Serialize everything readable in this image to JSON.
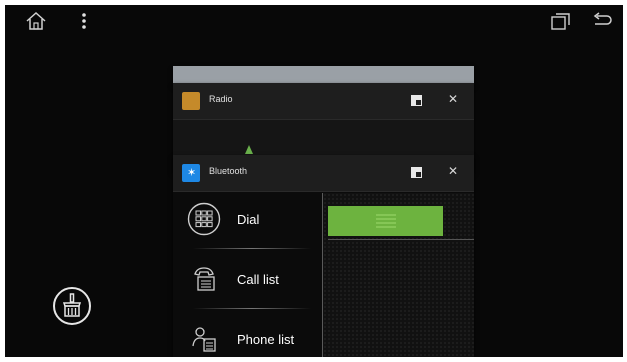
{
  "navbar": {
    "home_icon": "home-icon",
    "menu_icon": "overflow-menu-icon",
    "recents_icon": "recent-apps-icon",
    "back_icon": "back-icon"
  },
  "recents": {
    "cards": [
      {
        "title": "Radio",
        "icon": "radio-icon",
        "icon_color": "#c58a2a"
      },
      {
        "title": "Bluetooth",
        "icon": "bluetooth-icon",
        "icon_color": "#1e88e5"
      }
    ],
    "bluetooth_preview": {
      "menu": [
        {
          "label": "Dial",
          "icon": "dialpad-icon"
        },
        {
          "label": "Call list",
          "icon": "call-list-icon"
        },
        {
          "label": "Phone list",
          "icon": "phone-list-icon"
        }
      ],
      "accent": "#6db33f"
    }
  },
  "clear_all": {
    "icon": "broom-clear-icon"
  }
}
